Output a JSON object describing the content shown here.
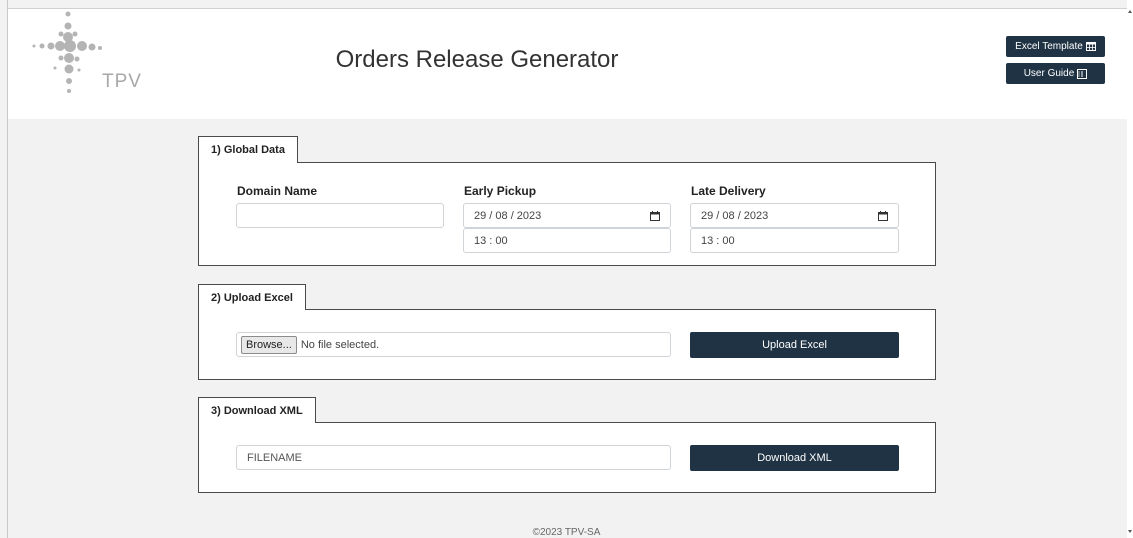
{
  "header": {
    "logo_text": "TPV",
    "title": "Orders Release Generator",
    "excel_template_label": "Excel Template",
    "user_guide_label": "User Guide"
  },
  "global_data": {
    "tab_label": "1) Global Data",
    "domain_label": "Domain Name",
    "domain_value": "",
    "early_pickup_label": "Early Pickup",
    "early_pickup_date": "29 / 08 / 2023",
    "early_pickup_time": "13 : 00",
    "late_delivery_label": "Late Delivery",
    "late_delivery_date": "29 / 08 / 2023",
    "late_delivery_time": "13 : 00"
  },
  "upload_excel": {
    "tab_label": "2) Upload Excel",
    "browse_label": "Browse...",
    "file_status": "No file selected.",
    "button_label": "Upload Excel"
  },
  "download_xml": {
    "tab_label": "3) Download XML",
    "filename_placeholder": "FILENAME",
    "button_label": "Download XML"
  },
  "footer": {
    "text": "©2023 TPV-SA"
  },
  "icons": {
    "excel_template": "table-icon",
    "user_guide": "book-icon",
    "date_picker": "calendar-icon"
  },
  "colors": {
    "button_bg": "#1f3344",
    "page_bg": "#f2f2f2",
    "panel_border": "#4a4a4a"
  }
}
